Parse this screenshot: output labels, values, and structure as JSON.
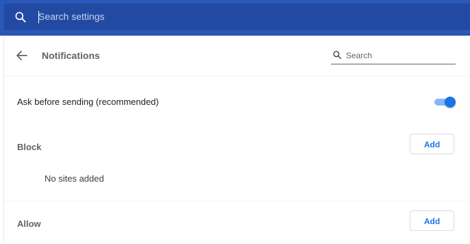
{
  "top_search": {
    "placeholder": "Search settings"
  },
  "header": {
    "title": "Notifications",
    "search_placeholder": "Search"
  },
  "ask": {
    "label": "Ask before sending (recommended)",
    "enabled": true
  },
  "block": {
    "label": "Block",
    "add_label": "Add",
    "empty_text": "No sites added"
  },
  "allow": {
    "label": "Allow",
    "add_label": "Add"
  },
  "colors": {
    "topbar": "#2a58b8",
    "accent": "#1a73e8"
  }
}
